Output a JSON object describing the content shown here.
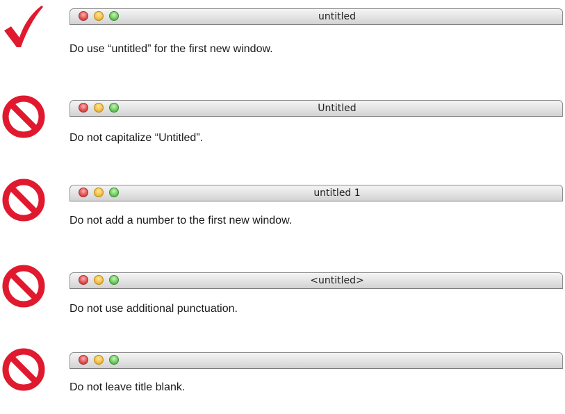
{
  "examples": [
    {
      "status": "do",
      "status_icon": "checkmark-icon",
      "window_title": "untitled",
      "caption": "Do use “untitled” for the first new window."
    },
    {
      "status": "dont",
      "status_icon": "prohibited-icon",
      "window_title": "Untitled",
      "caption": "Do not capitalize “Untitled”."
    },
    {
      "status": "dont",
      "status_icon": "prohibited-icon",
      "window_title": "untitled 1",
      "caption": "Do not add a number to the first new window."
    },
    {
      "status": "dont",
      "status_icon": "prohibited-icon",
      "window_title": "<untitled>",
      "caption": "Do not use additional punctuation."
    },
    {
      "status": "dont",
      "status_icon": "prohibited-icon",
      "window_title": "",
      "caption": "Do not leave title blank."
    }
  ],
  "colors": {
    "do": "#e0192e",
    "dont": "#e0192e"
  }
}
